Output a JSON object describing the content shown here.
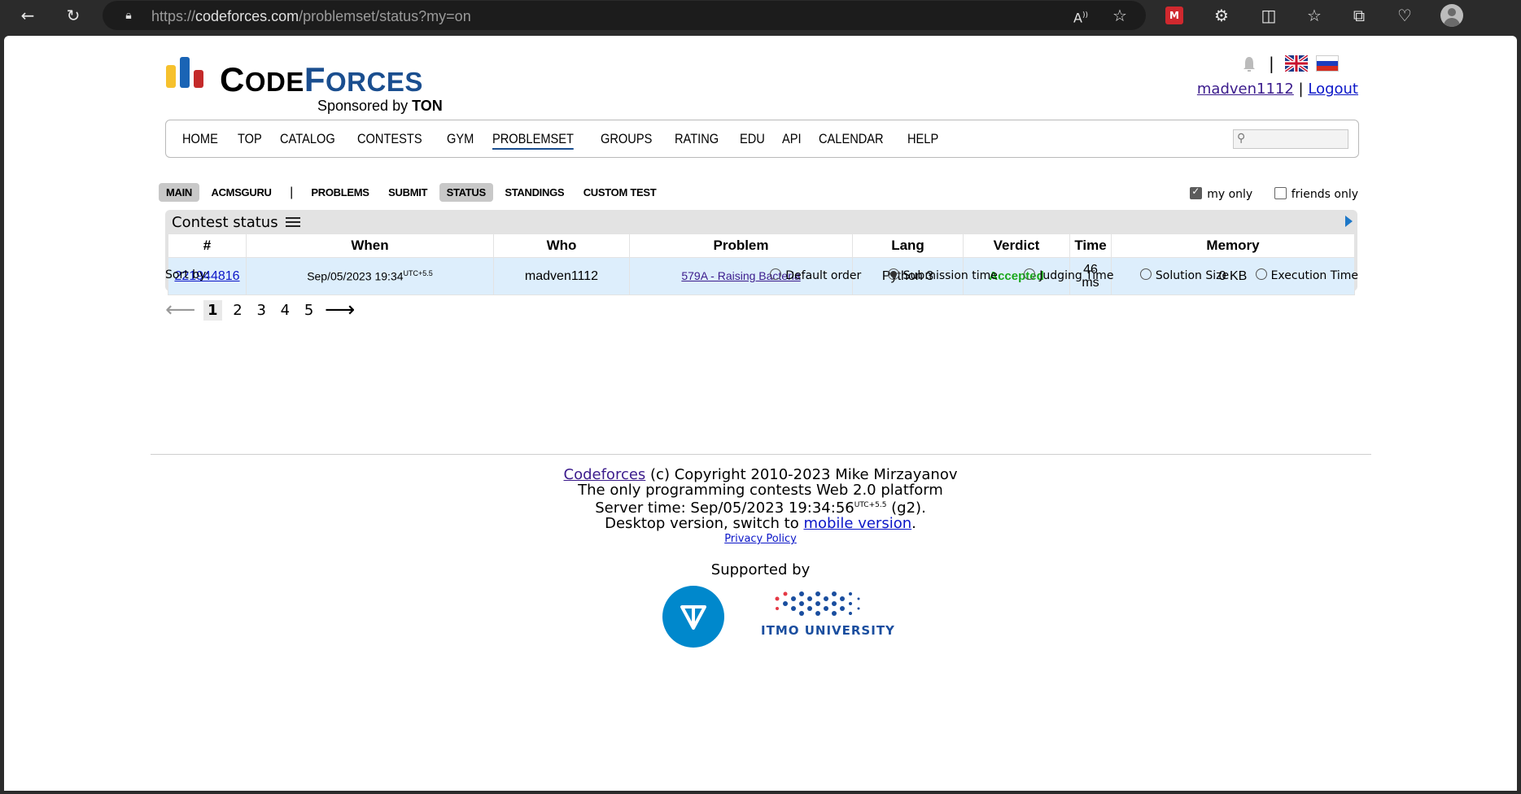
{
  "browser": {
    "url_prefix": "https://",
    "url_host": "codeforces.com",
    "url_path": "/problemset/status?my=on"
  },
  "header": {
    "logo_c1": "C",
    "logo_ode": "ODE",
    "logo_f": "F",
    "logo_orces": "ORCES",
    "sponsored_by": "Sponsored by",
    "sponsor_name": "TON",
    "separator": "|",
    "username": "madven1112",
    "logout": "Logout"
  },
  "menu": [
    "HOME",
    "TOP",
    "CATALOG",
    "CONTESTS",
    "GYM",
    "PROBLEMSET",
    "GROUPS",
    "RATING",
    "EDU",
    "API",
    "CALENDAR",
    "HELP"
  ],
  "menu_active": "PROBLEMSET",
  "submenu": {
    "main": "MAIN",
    "acmsguru": "ACMSGURU",
    "bar": "|",
    "problems": "PROBLEMS",
    "submit": "SUBMIT",
    "status": "STATUS",
    "standings": "STANDINGS",
    "custom_test": "CUSTOM TEST"
  },
  "filters": {
    "my_only": "my only",
    "my_only_checked": true,
    "friends_only": "friends only",
    "friends_only_checked": false
  },
  "status": {
    "title": "Contest status",
    "columns": [
      "#",
      "When",
      "Who",
      "Problem",
      "Lang",
      "Verdict",
      "Time",
      "Memory"
    ],
    "rows": [
      {
        "id": "221944816",
        "when": "Sep/05/2023 19:34",
        "tz": "UTC+5.5",
        "who": "madven1112",
        "problem": "579A - Raising Bacteria",
        "lang": "Python 3",
        "verdict": "Accepted",
        "time_value": "46",
        "time_unit": "ms",
        "memory": "0 KB"
      }
    ]
  },
  "sort": {
    "label": "Sort by:",
    "options": [
      "Default order",
      "Submission time",
      "Judging Time",
      "Solution Size",
      "Execution Time"
    ],
    "selected": "Submission time"
  },
  "pager": {
    "prev": "⟵",
    "next": "⟶",
    "pages": [
      "1",
      "2",
      "3",
      "4",
      "5"
    ],
    "current": "1"
  },
  "footer": {
    "codeforces": "Codeforces",
    "copyright": " (c) Copyright 2010-2023 Mike Mirzayanov",
    "line2": "The only programming contests Web 2.0 platform",
    "server_time_label": "Server time: ",
    "server_time": "Sep/05/2023 19:34:56",
    "server_tz": "UTC+5.5",
    "server_suffix": " (g2).",
    "desktop_prefix": "Desktop version, switch to ",
    "mobile": "mobile version",
    "desktop_suffix": ".",
    "privacy": "Privacy Policy",
    "supported_by": "Supported by",
    "itmo": "ITMO UNIVERSITY"
  },
  "colors": {
    "accent": "#1a4e8f",
    "accepted": "#1aa81a",
    "row_bg": "#ddeefc"
  }
}
